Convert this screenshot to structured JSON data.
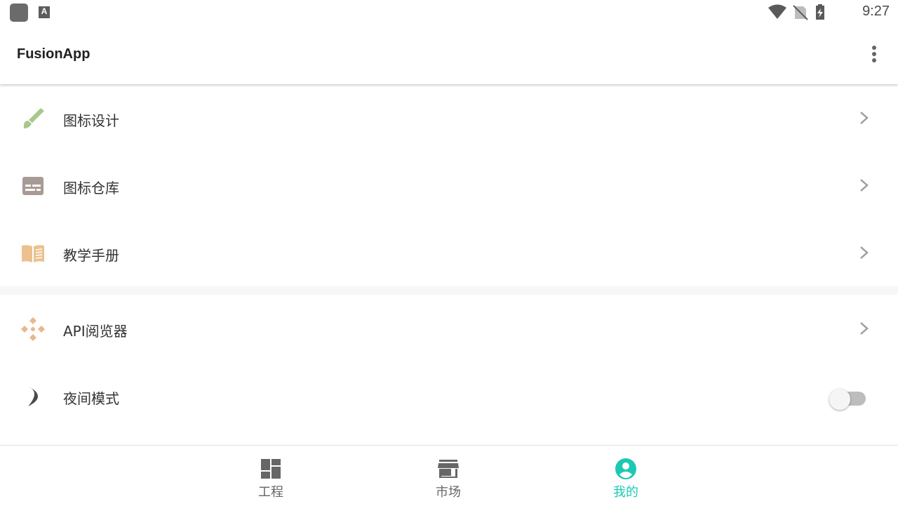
{
  "status_bar": {
    "time": "9:27",
    "icons": [
      "app-notification-icon",
      "a-notification-icon",
      "wifi-icon",
      "no-sim-icon",
      "battery-charging-icon"
    ]
  },
  "app_bar": {
    "title": "FusionApp",
    "overflow_icon": "more-vert-icon"
  },
  "menu": {
    "items": [
      {
        "label": "图标设计",
        "icon": "brush-icon",
        "color": "#a8c88a",
        "action": "chevron"
      },
      {
        "label": "图标仓库",
        "icon": "storage-icon",
        "color": "#a89a94",
        "action": "chevron"
      },
      {
        "label": "教学手册",
        "icon": "book-icon",
        "color": "#ecc18e",
        "action": "chevron"
      },
      {
        "label": "API阅览器",
        "icon": "api-icon",
        "color": "#e8b98a",
        "action": "chevron"
      },
      {
        "label": "夜间模式",
        "icon": "moon-icon",
        "color": "#4a4a4a",
        "action": "toggle",
        "toggle_on": false
      }
    ]
  },
  "bottom_nav": {
    "items": [
      {
        "label": "工程",
        "icon": "dashboard-icon",
        "active": false
      },
      {
        "label": "市场",
        "icon": "store-icon",
        "active": false
      },
      {
        "label": "我的",
        "icon": "account-circle-icon",
        "active": true
      }
    ],
    "active_color": "#1ec8b4",
    "inactive_color": "#666666"
  }
}
